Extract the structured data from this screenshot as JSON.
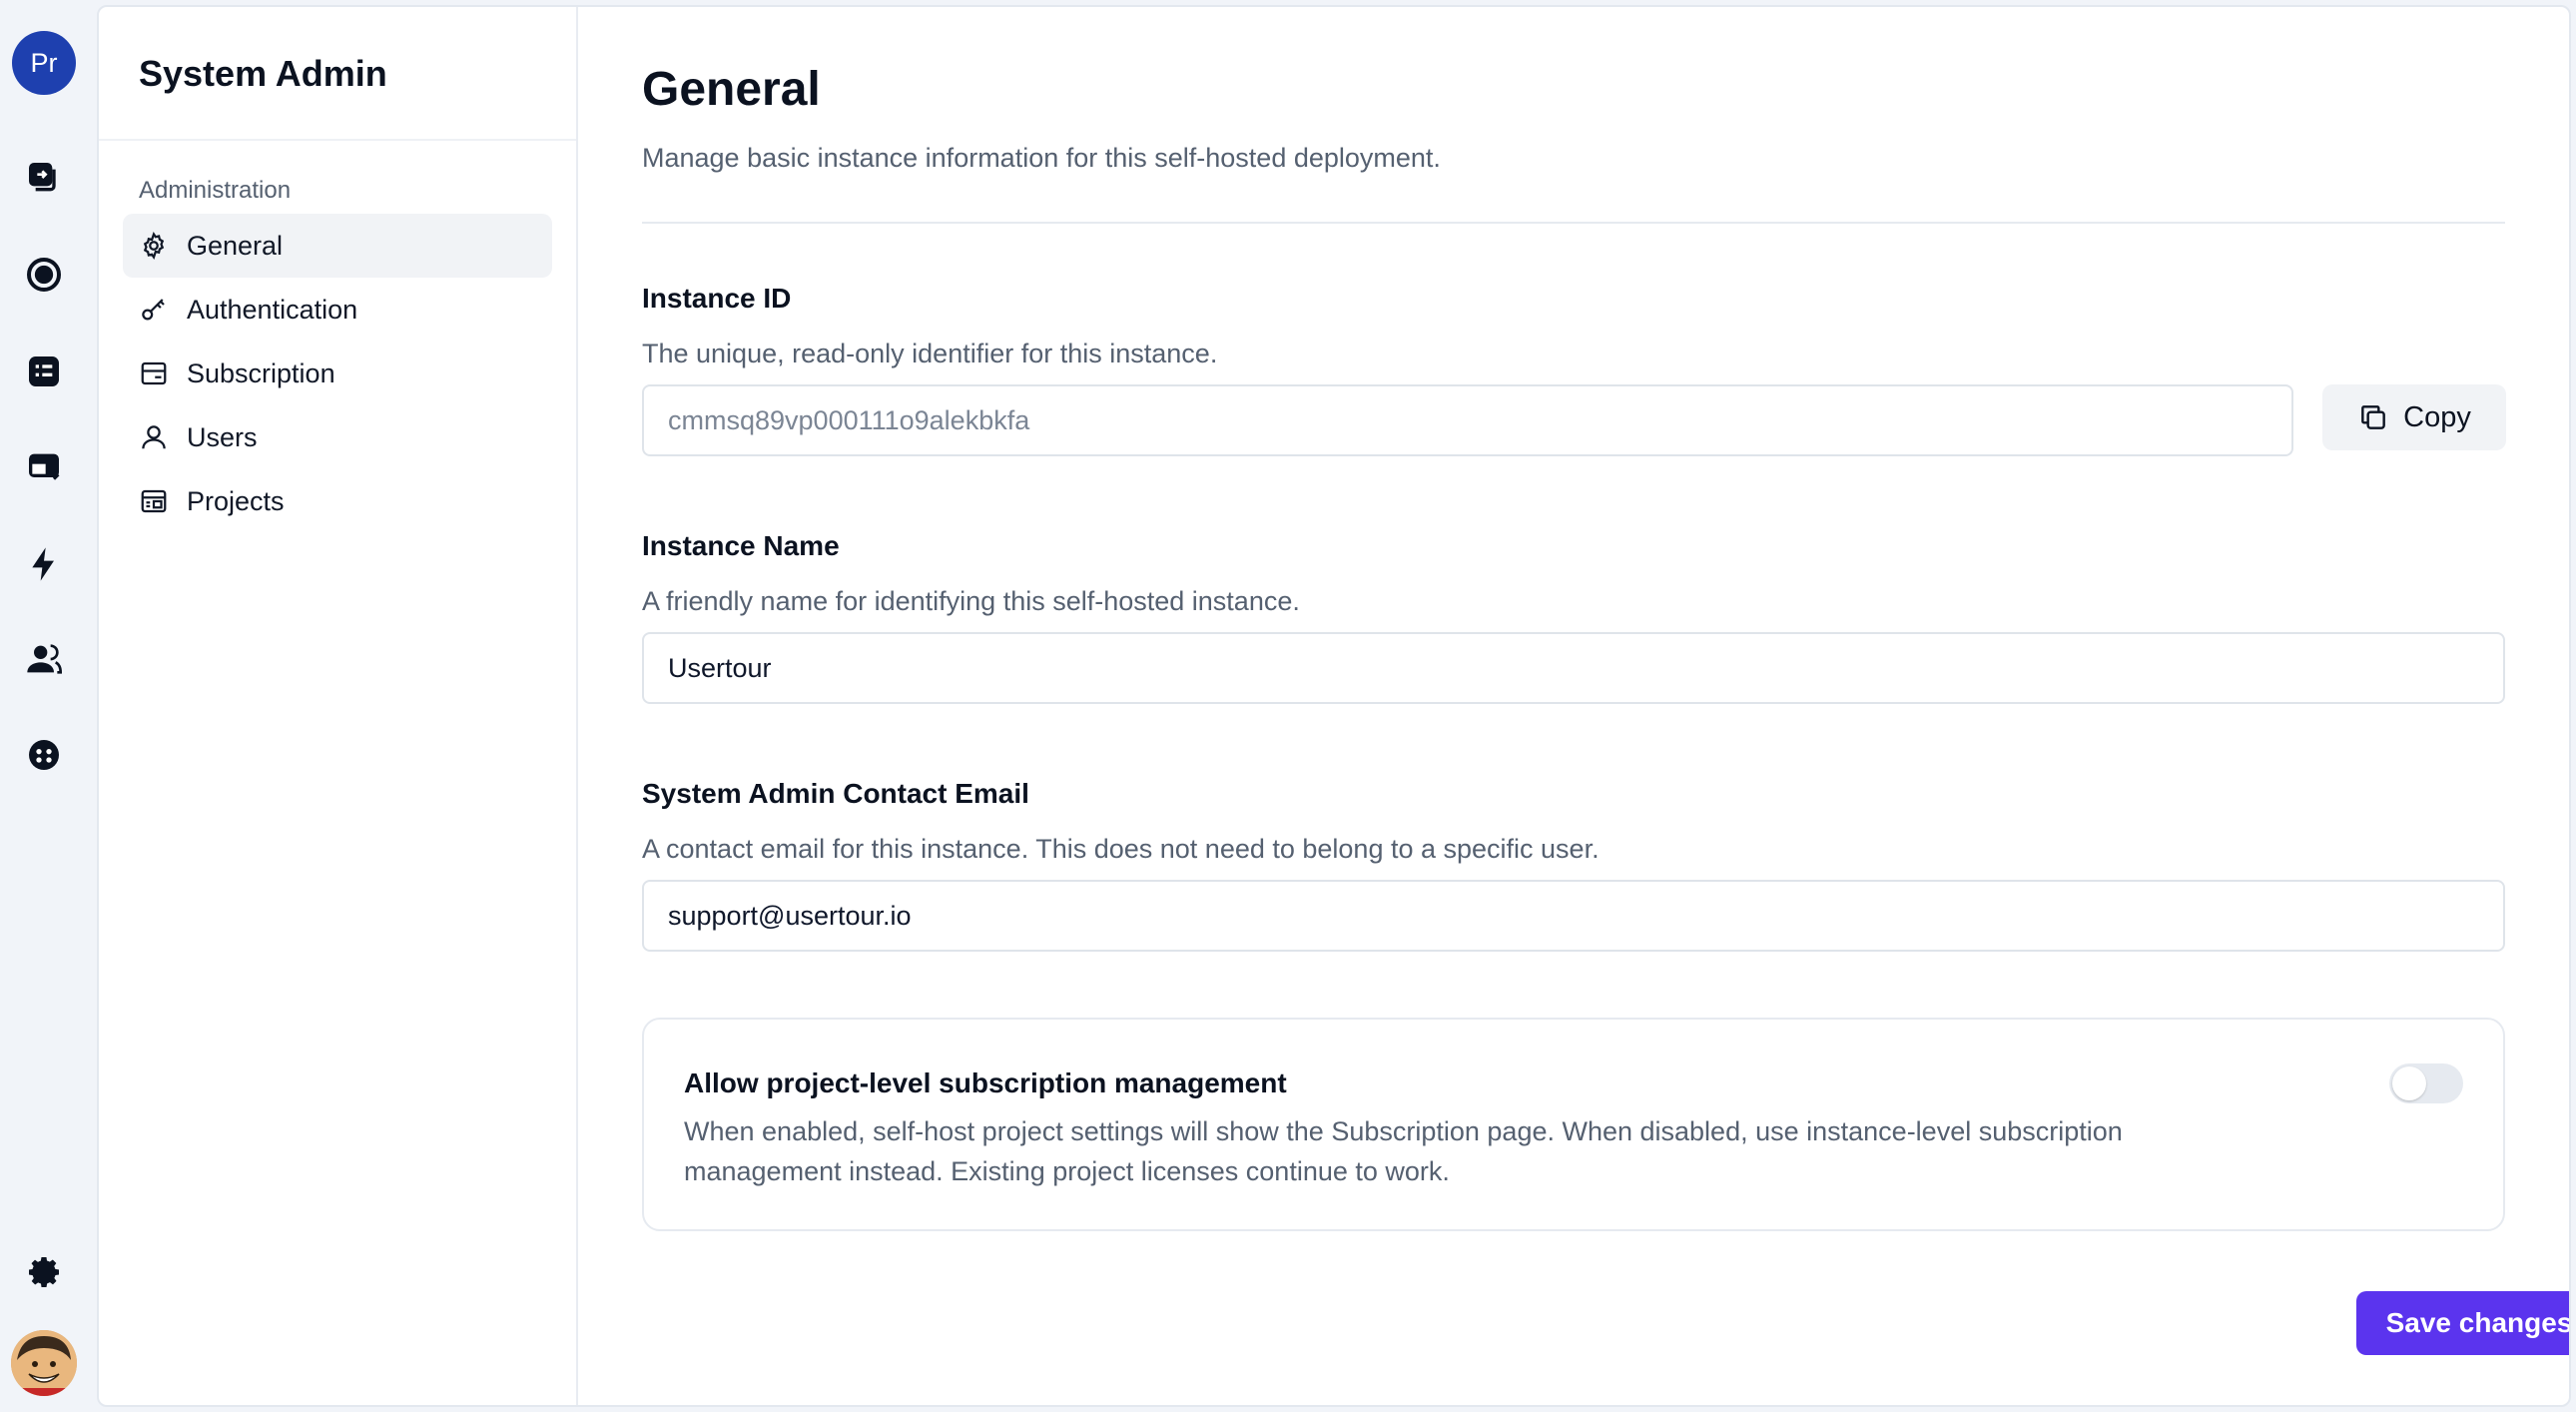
{
  "rail": {
    "project_initials": "Pr",
    "icons": [
      "flows-icon",
      "launchers-icon",
      "checklists-icon",
      "banners-icon",
      "events-icon",
      "users-icon",
      "companies-icon",
      "settings-icon",
      "user-avatar"
    ]
  },
  "sidenav": {
    "title": "System Admin",
    "section": "Administration",
    "items": [
      {
        "label": "General",
        "icon": "gear-icon",
        "active": true
      },
      {
        "label": "Authentication",
        "icon": "key-icon",
        "active": false
      },
      {
        "label": "Subscription",
        "icon": "subscription-icon",
        "active": false
      },
      {
        "label": "Users",
        "icon": "user-icon",
        "active": false
      },
      {
        "label": "Projects",
        "icon": "projects-icon",
        "active": false
      }
    ]
  },
  "main": {
    "title": "General",
    "subtitle": "Manage basic instance information for this self-hosted deployment.",
    "instance_id": {
      "label": "Instance ID",
      "help": "The unique, read-only identifier for this instance.",
      "value": "cmmsq89vp000111o9alekbkfa",
      "copy_label": "Copy"
    },
    "instance_name": {
      "label": "Instance Name",
      "help": "A friendly name for identifying this self-hosted instance.",
      "value": "Usertour"
    },
    "contact_email": {
      "label": "System Admin Contact Email",
      "help": "A contact email for this instance. This does not need to belong to a specific user.",
      "value": "support@usertour.io"
    },
    "project_subscription": {
      "title": "Allow project-level subscription management",
      "description": "When enabled, self-host project settings will show the Subscription page. When disabled, use instance-level subscription management instead. Existing project licenses continue to work.",
      "enabled": false
    },
    "save_label": "Save changes"
  },
  "colors": {
    "accent": "#5b34ee",
    "avatar_bg": "#1e40af",
    "muted_text": "#556070"
  }
}
